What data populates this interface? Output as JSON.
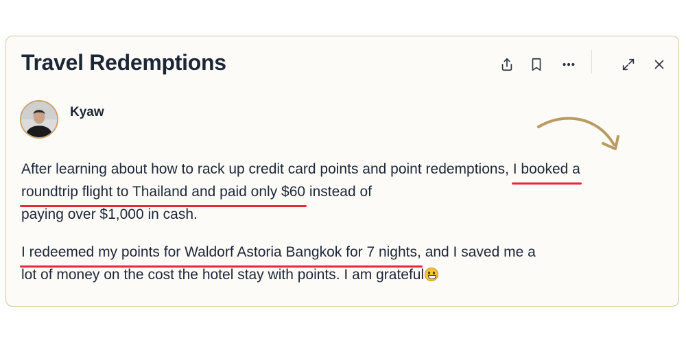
{
  "card": {
    "title": "Travel Redemptions"
  },
  "toolbar": {
    "share_icon": "share-icon",
    "bookmark_icon": "bookmark-icon",
    "more_icon": "more-icon",
    "expand_icon": "expand-icon",
    "close_icon": "close-icon"
  },
  "post": {
    "author": "Kyaw",
    "paragraph1": {
      "text1": "After learning about how to rack up credit card points and point redemptions,",
      "highlight1": "I booked a",
      "highlight2": "roundtrip flight to Thailand and paid only $60",
      "text2": "instead of",
      "text3": "paying over $1,000 in cash."
    },
    "paragraph2": {
      "highlight1": "I redeemed my points for Waldorf Astoria Bangkok for 7 nights,",
      "text1": "and I saved me a",
      "text2": "lot of money on the cost the hotel stay with points. I am grateful"
    }
  },
  "colors": {
    "card_border": "#d8c29a",
    "underline": "#e5283a",
    "arrow": "#b99a62",
    "text": "#1c2636"
  }
}
